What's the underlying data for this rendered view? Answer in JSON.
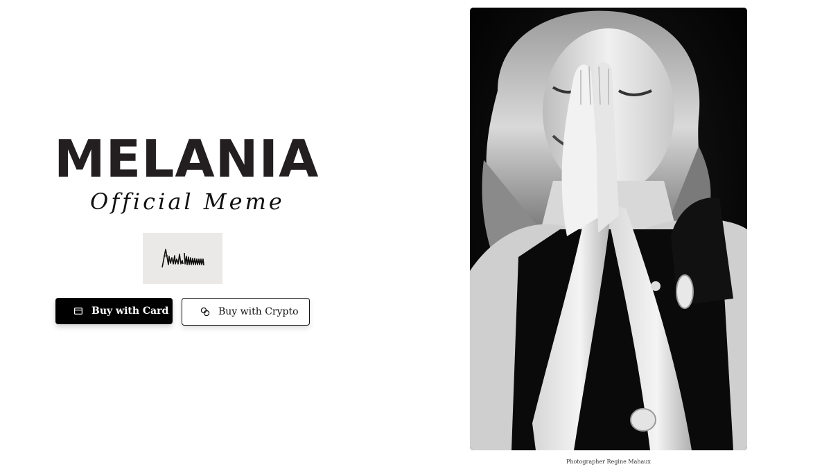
{
  "brand": {
    "title": "MELANIA",
    "subtitle": "Official Meme"
  },
  "signature": {
    "icon": "signature-image"
  },
  "actions": {
    "buy_card_label": "Buy with Card",
    "buy_card_icon": "credit-card-icon",
    "buy_crypto_label": "Buy with Crypto",
    "buy_crypto_icon": "coins-icon"
  },
  "photo": {
    "style": "black-and-white portrait",
    "credit": "Photographer Regine Mahaux"
  },
  "colors": {
    "background": "#ffffff",
    "text": "#231f20",
    "primary_button": "#000000",
    "signature_box": "#ebe9e7"
  }
}
